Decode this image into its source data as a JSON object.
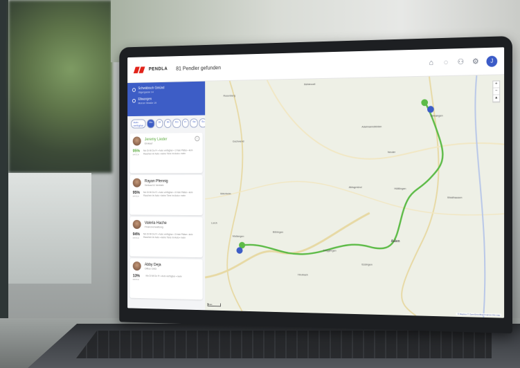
{
  "app": {
    "logo_text": "PENDLA",
    "header_title": "81 Pendler gefunden",
    "header_icons": [
      "home-icon",
      "chat-icon",
      "people-icon",
      "gear-icon"
    ],
    "avatar_initial": "J"
  },
  "route": {
    "from": {
      "main": "Schwäbisch Gmünd",
      "sub": "Jägergasse 14"
    },
    "to": {
      "main": "Ellwangen",
      "sub": "Mercer Straße 19"
    }
  },
  "filters": [
    {
      "label": "Auto verfügbar",
      "active": false
    },
    {
      "label": "Mo",
      "active": true
    },
    {
      "label": "Di",
      "active": false
    },
    {
      "label": "Mi",
      "active": false
    },
    {
      "label": "Do",
      "active": false
    },
    {
      "label": "Fr",
      "active": false
    },
    {
      "label": "Sa",
      "active": false
    },
    {
      "label": "So",
      "active": false
    }
  ],
  "cards": [
    {
      "name": "Jeremy Lieder",
      "role": "Einkauf",
      "match": "95%",
      "match_label": "MATCH",
      "text": "Mo Di Mi Do Fr • Auto verfügbar • 1 freie Plätze • kein Rauchen im Auto • keine Tiere im Auto • mehr"
    },
    {
      "name": "Rayan Pfennig",
      "role": "Verkauf & Vertrieb",
      "match": "95%",
      "match_label": "MATCH",
      "text": "Mo Di Mi Do Fr • Auto verfügbar • 3 freie Plätze • kein Rauchen im Auto • keine Tiere im Auto • mehr"
    },
    {
      "name": "Valeria Hache",
      "role": "Finanzverwaltung",
      "match": "94%",
      "match_label": "MATCH",
      "text": "Mo Di Mi Do Fr • Auto verfügbar • 3 freie Plätze • kein Rauchen im Auto • keine Tiere im Auto • mehr"
    },
    {
      "name": "Abby Deja",
      "role": "Office OAD",
      "match": "13%",
      "match_label": "MATCH",
      "text": "Mo Di Mi Do Fr • Auto verfügbar • mehr"
    }
  ],
  "map": {
    "labels": [
      "Rosenberg",
      "Gschwend",
      "Welzheim",
      "Mutlangen",
      "Heubach",
      "Essingen",
      "Aalen",
      "Abtsgmünd",
      "Hüttlingen",
      "Adelmannsfelden",
      "Neuler",
      "Westhausen",
      "Ellwangen",
      "Lorch",
      "Böbingen",
      "Mögglingen",
      "Bühlerzell"
    ],
    "zoom": [
      "+",
      "−",
      "▴"
    ],
    "attribution": "© Mapbox © OpenStreetMap Improve this map",
    "scale": "5 km"
  }
}
